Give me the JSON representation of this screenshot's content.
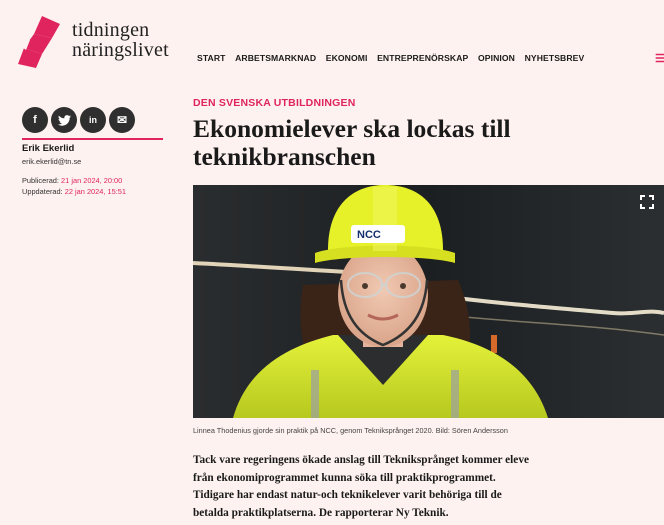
{
  "brand": {
    "line1": "tidningen",
    "line2": "näringslivet",
    "color": "#e0245e"
  },
  "nav": {
    "items": [
      "START",
      "ARBETSMARKNAD",
      "EKONOMI",
      "ENTREPRENÖRSKAP",
      "OPINION",
      "NYHETSBREV"
    ],
    "menu_icon": "hamburger-icon"
  },
  "share": {
    "buttons": [
      {
        "icon": "facebook-icon",
        "glyph": "f"
      },
      {
        "icon": "twitter-icon",
        "glyph": "t"
      },
      {
        "icon": "linkedin-icon",
        "glyph": "in"
      },
      {
        "icon": "mail-icon",
        "glyph": "✉"
      }
    ]
  },
  "author": {
    "name": "Erik Ekerlid",
    "email": "erik.ekerlid@tn.se"
  },
  "meta": {
    "published_label": "Publicerad:",
    "published_date": "21 jan 2024, 20:00",
    "updated_label": "Uppdaterad:",
    "updated_date": "22 jan 2024, 15:51"
  },
  "article": {
    "kicker": "DEN SVENSKA UTBILDNINGEN",
    "headline_l1": "Ekonomielever ska lockas till",
    "headline_l2": "teknikbranschen",
    "photo": {
      "helmet_text": "NCC",
      "expand_icon": "fullscreen-icon"
    },
    "caption": "Linnea Thodenius gjorde sin praktik på NCC, genom Tekniksprånget 2020. Bild: Sören Andersson",
    "lead": [
      "Tack vare regeringens ökade anslag till Tekniksprånget kommer eleve",
      "från ekonomiprogrammet kunna söka till praktikprogrammet.",
      "Tidigare har endast natur-och teknikelever varit behöriga till de",
      "betalda praktikplatserna. De rapporterar Ny Teknik."
    ]
  }
}
